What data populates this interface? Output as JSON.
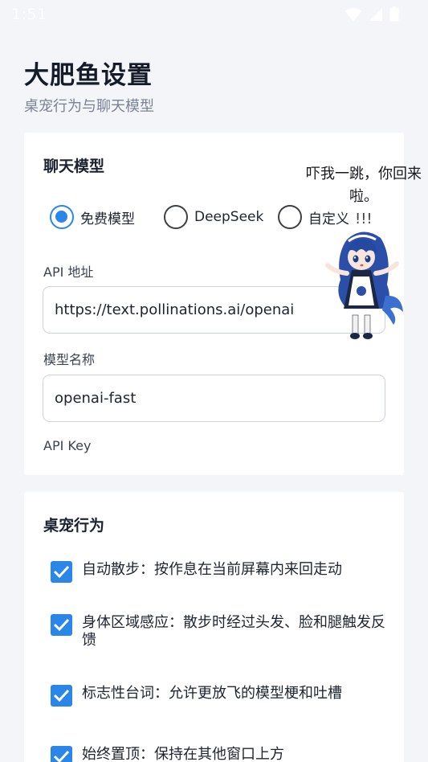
{
  "status": {
    "time": "1:51"
  },
  "header": {
    "title": "大肥鱼设置",
    "subtitle": "桌宠行为与聊天模型"
  },
  "chat_model": {
    "title": "聊天模型",
    "options": [
      {
        "label": "免费模型",
        "selected": true
      },
      {
        "label": "DeepSeek",
        "selected": false
      },
      {
        "label": "自定义",
        "selected": false
      }
    ],
    "api_label": "API 地址",
    "api_value": "https://text.pollinations.ai/openai",
    "model_label": "模型名称",
    "model_value": "openai-fast",
    "key_label": "API Key"
  },
  "pet_behavior": {
    "title": "桌宠行为",
    "items": [
      {
        "label": "自动散步：按作息在当前屏幕内来回走动",
        "checked": true
      },
      {
        "label": "身体区域感应：散步时经过头发、脸和腿触发反馈",
        "checked": true
      },
      {
        "label": "标志性台词：允许更放飞的模型梗和吐槽",
        "checked": true
      },
      {
        "label": "始终置顶：保持在其他窗口上方",
        "checked": true
      }
    ]
  },
  "pet_overlay": {
    "speech": "吓我一跳，你回来啦。",
    "shock_mark": "!!!"
  },
  "colors": {
    "accent": "#2a86e8",
    "background": "#f3f5f9",
    "card": "#ffffff"
  }
}
